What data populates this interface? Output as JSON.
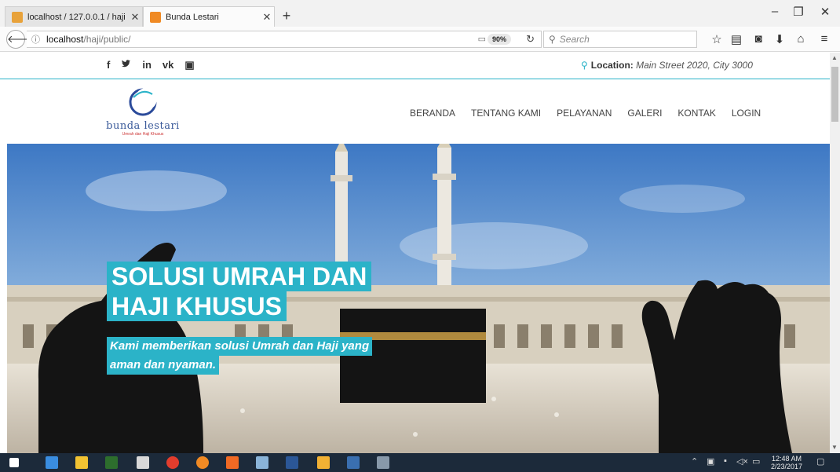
{
  "browser": {
    "tabs": [
      {
        "label": "localhost / 127.0.0.1 / haji ...",
        "favicon_color": "#e8a23a"
      },
      {
        "label": "Bunda Lestari",
        "favicon_color": "#f08a24"
      }
    ],
    "window_controls": {
      "minimize": "–",
      "restore": "❐",
      "close": "✕"
    },
    "url_host": "localhost",
    "url_path": "/haji/public/",
    "zoom": "90%",
    "search_placeholder": "Search"
  },
  "site": {
    "social_icons": [
      "f",
      "🐦",
      "in",
      "vk",
      "▣"
    ],
    "social_names": [
      "facebook-icon",
      "twitter-icon",
      "linkedin-icon",
      "vk-icon",
      "instagram-icon"
    ],
    "location_label": "Location:",
    "location_value": "Main Street 2020, City 3000",
    "logo_name": "bunda lestari",
    "logo_tag": "Umrah dan Haji Khusus",
    "menu": [
      "BERANDA",
      "TENTANG KAMI",
      "PELAYANAN",
      "GALERI",
      "KONTAK",
      "LOGIN"
    ],
    "hero_title_line1": "SOLUSI UMRAH DAN",
    "hero_title_line2": "HAJI KHUSUS",
    "hero_sub_line1": "Kami memberikan solusi Umrah dan Haji yang",
    "hero_sub_line2": "aman dan nyaman.",
    "accent_color": "#2bb3c8"
  },
  "taskbar": {
    "time": "12:48 AM",
    "date": "2/23/2017"
  }
}
